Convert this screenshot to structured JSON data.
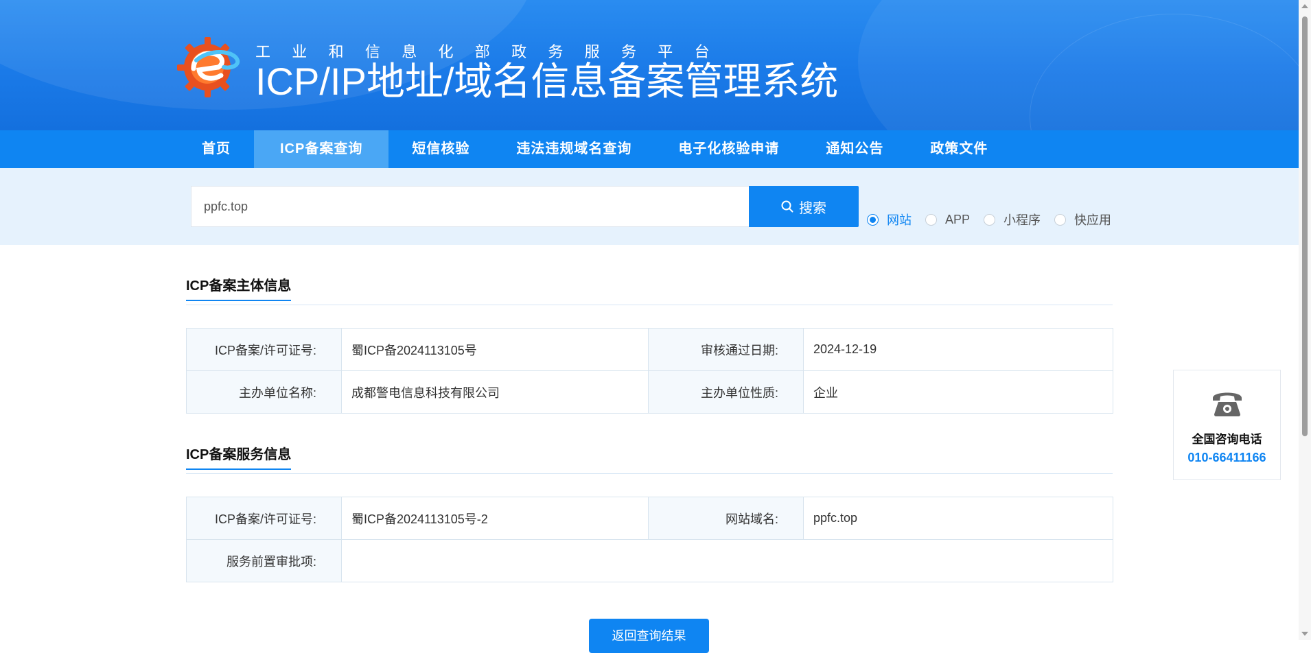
{
  "header": {
    "org_chars": [
      "工",
      "业",
      "和",
      "信",
      "息",
      "化",
      "部",
      "政",
      "务",
      "服",
      "务",
      "平",
      "台"
    ],
    "title": "ICP/IP地址/域名信息备案管理系统",
    "logo": "miit-gear-e-logo"
  },
  "nav": {
    "items": [
      {
        "label": "首页",
        "active": false
      },
      {
        "label": "ICP备案查询",
        "active": true
      },
      {
        "label": "短信核验",
        "active": false
      },
      {
        "label": "违法违规域名查询",
        "active": false
      },
      {
        "label": "电子化核验申请",
        "active": false
      },
      {
        "label": "通知公告",
        "active": false
      },
      {
        "label": "政策文件",
        "active": false
      }
    ]
  },
  "search": {
    "value": "ppfc.top",
    "button_label": "搜索",
    "types": [
      {
        "label": "网站",
        "checked": true
      },
      {
        "label": "APP",
        "checked": false
      },
      {
        "label": "小程序",
        "checked": false
      },
      {
        "label": "快应用",
        "checked": false
      }
    ]
  },
  "subject": {
    "title": "ICP备案主体信息",
    "license_label": "ICP备案/许可证号:",
    "license_value": "蜀ICP备2024113105号",
    "approve_label": "审核通过日期:",
    "approve_value": "2024-12-19",
    "org_label": "主办单位名称:",
    "org_value": "成都警电信息科技有限公司",
    "nature_label": "主办单位性质:",
    "nature_value": "企业"
  },
  "service": {
    "title": "ICP备案服务信息",
    "license_label": "ICP备案/许可证号:",
    "license_value": "蜀ICP备2024113105号-2",
    "domain_label": "网站域名:",
    "domain_value": "ppfc.top",
    "preapprove_label": "服务前置审批项:",
    "preapprove_value": ""
  },
  "back_button": "返回查询结果",
  "consult": {
    "icon": "telephone-icon",
    "title": "全国咨询电话",
    "phone": "010-66411166"
  },
  "colors": {
    "primary": "#0f85f2",
    "banner": "#1a7ae8",
    "strip": "#e6f2fd",
    "label_bg": "#f4f9fd"
  }
}
